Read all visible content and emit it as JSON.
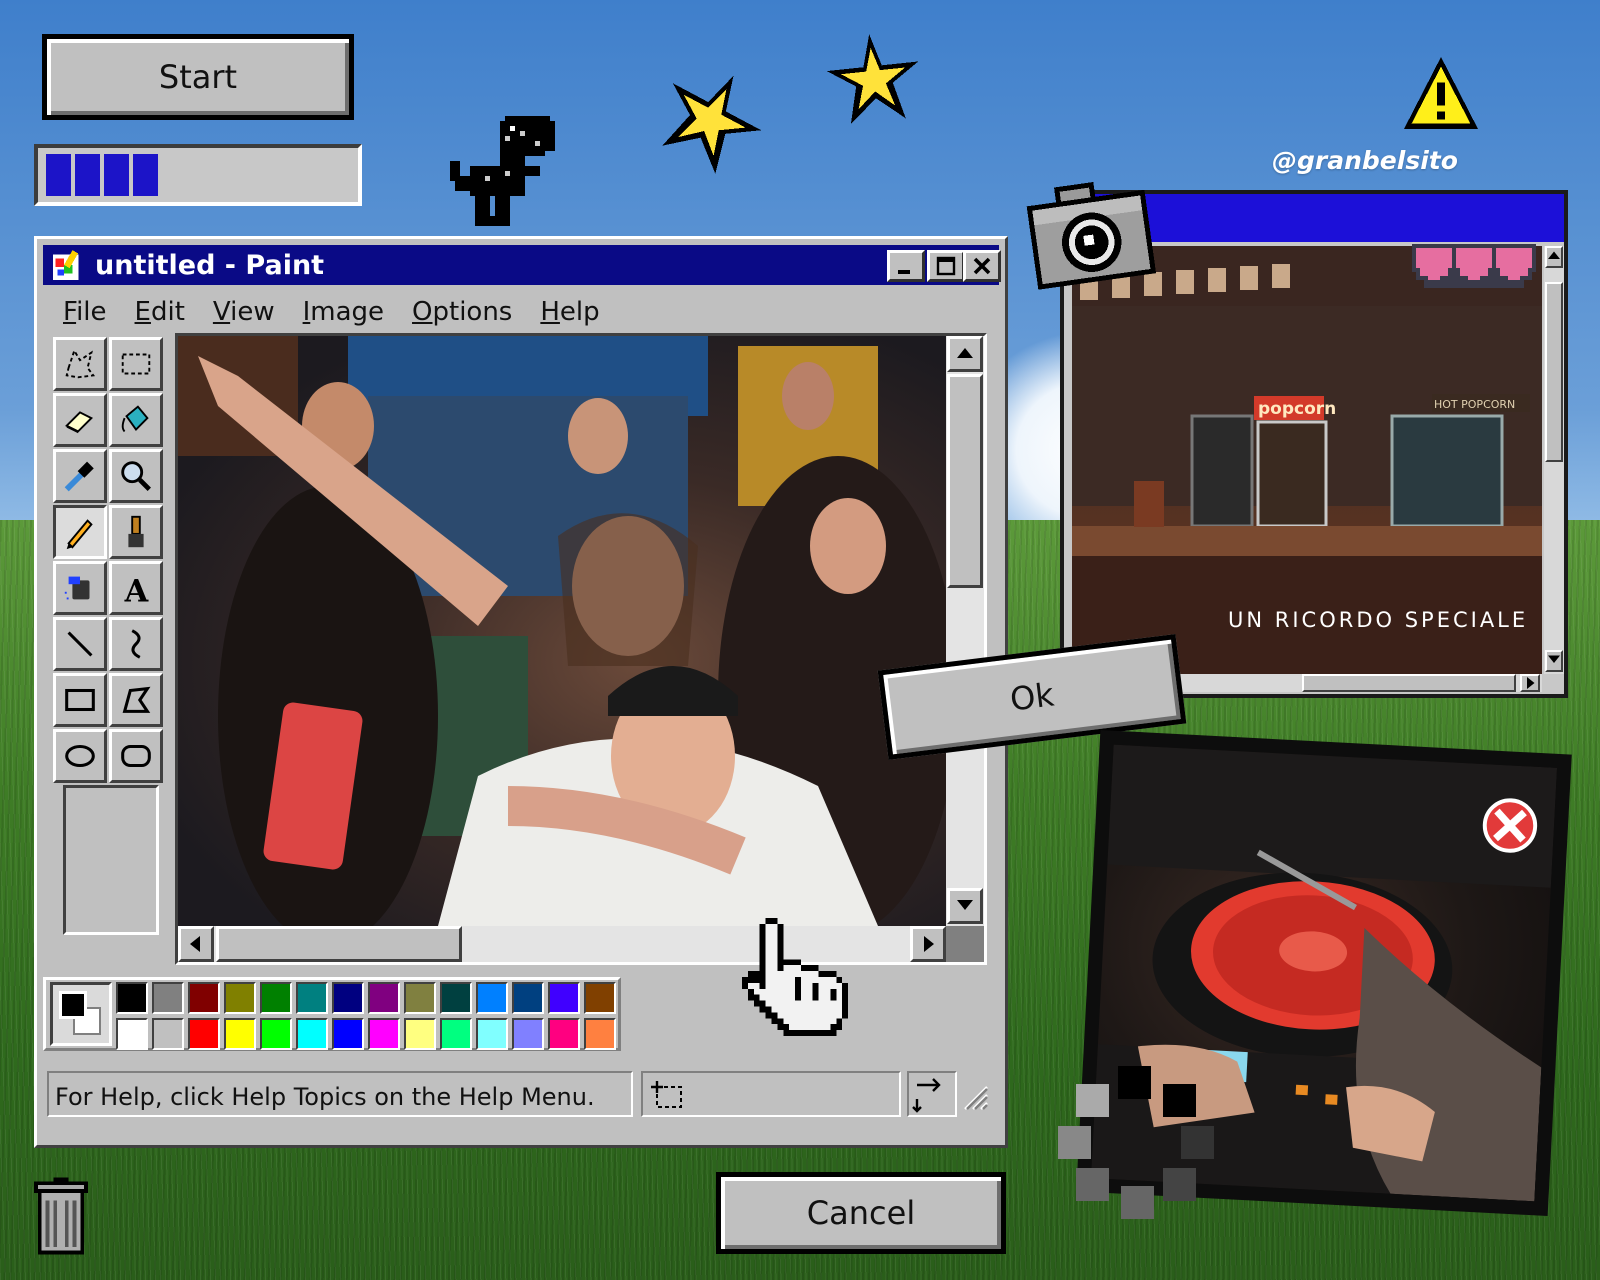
{
  "desktop": {
    "start_label": "Start",
    "ok_label": "Ok",
    "cancel_label": "Cancel",
    "username": "@granbelsito",
    "progress": {
      "filled_segments": 4,
      "total_segments": 10
    }
  },
  "paint": {
    "title": "untitled - Paint",
    "menu": [
      {
        "key": "F",
        "rest": "ile"
      },
      {
        "key": "E",
        "rest": "dit"
      },
      {
        "key": "V",
        "rest": "iew"
      },
      {
        "key": "I",
        "rest": "mage"
      },
      {
        "key": "O",
        "rest": "ptions"
      },
      {
        "key": "H",
        "rest": "elp"
      }
    ],
    "tools": [
      "free-select",
      "select",
      "eraser",
      "fill",
      "color-picker",
      "magnifier",
      "pencil",
      "brush",
      "airbrush",
      "text",
      "line",
      "curve",
      "rectangle",
      "polygon",
      "ellipse",
      "rounded-rectangle"
    ],
    "active_tool": "pencil",
    "palette_top": [
      "#000000",
      "#808080",
      "#800000",
      "#808000",
      "#008000",
      "#008080",
      "#000080",
      "#800080",
      "#808040",
      "#004040",
      "#0080ff",
      "#004080",
      "#4000ff",
      "#804000"
    ],
    "palette_bottom": [
      "#ffffff",
      "#c0c0c0",
      "#ff0000",
      "#ffff00",
      "#00ff00",
      "#00ffff",
      "#0000ff",
      "#ff00ff",
      "#ffff80",
      "#00ff80",
      "#80ffff",
      "#8080ff",
      "#ff0080",
      "#ff8040"
    ],
    "status_text": "For Help, click Help Topics on the Help Menu."
  },
  "cinema": {
    "caption": "UN RICORDO SPECIALE",
    "sign_popcorn": "popcorn",
    "sign_hot_popcorn": "HOT POPCORN"
  },
  "colors": {
    "title_bar": "#0a0a86",
    "cinema_title_bar": "#1c10d8",
    "progress_fill": "#1c14c8",
    "window_gray": "#c0c0c0"
  }
}
